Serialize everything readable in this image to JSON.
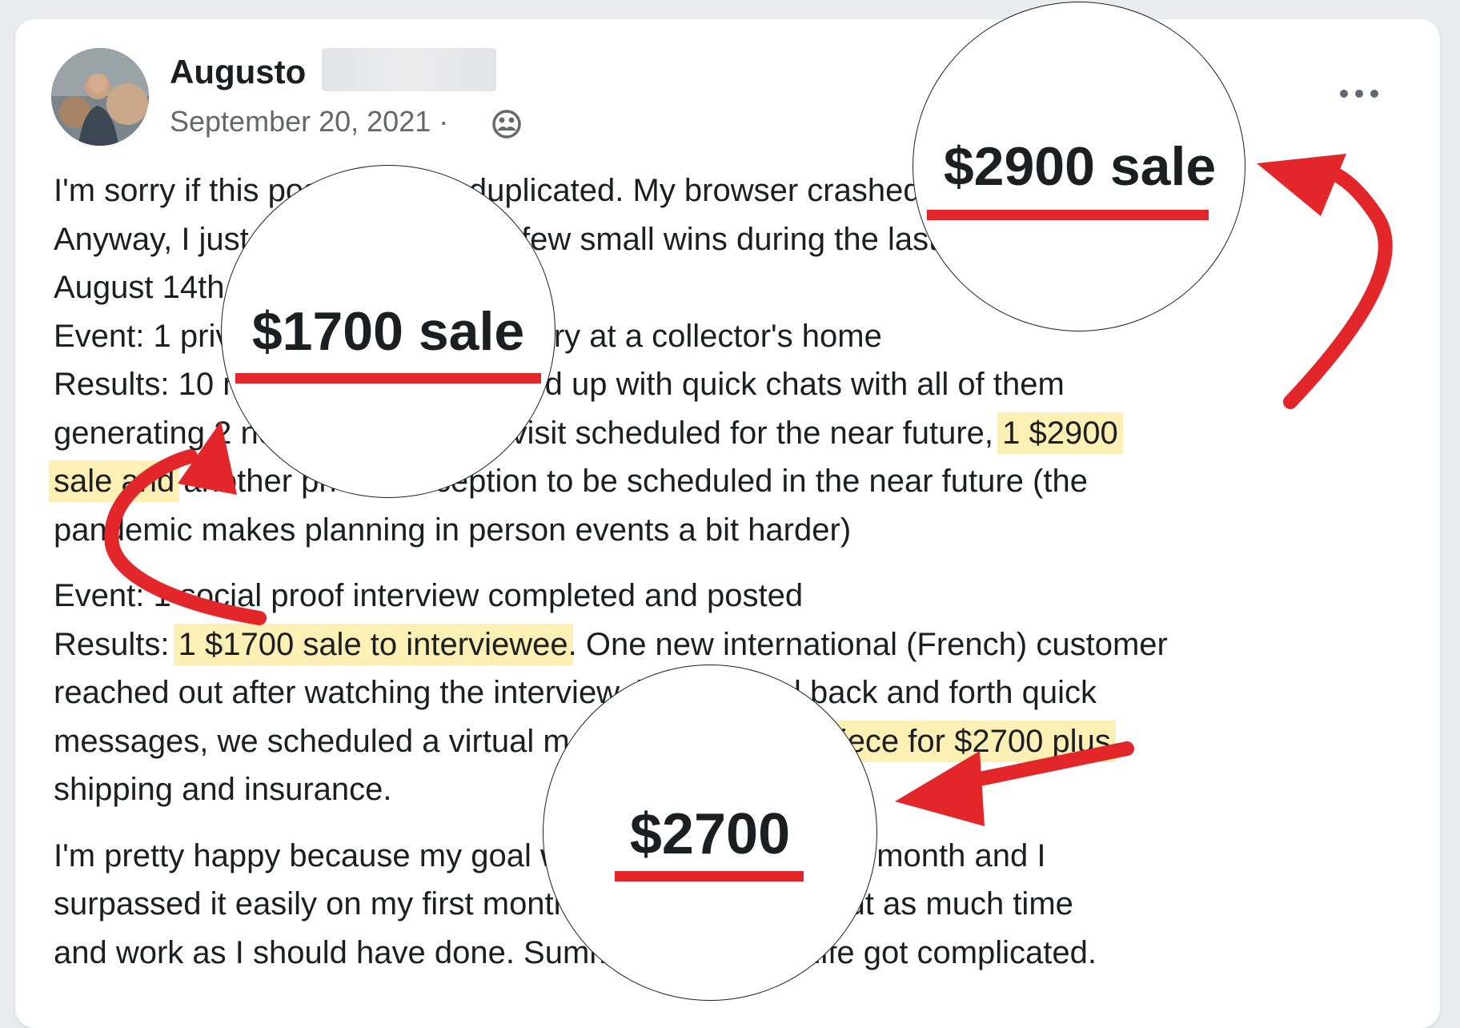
{
  "post": {
    "author": "Augusto",
    "date": "September 20, 2021 ·",
    "avatar": "avatar-photo",
    "audience_icon": "friends-icon",
    "more_icon": "more-options-icon",
    "paragraphs": {
      "p1": {
        "line1": "I'm sorry if this post might be duplicated. My browser crashed out.",
        "line2": "Anyway, I just wanted to share a few small wins during the last 5 weeks starting",
        "line3": "August 14th.",
        "line4": "Event: 1 private reception in a gallery at a collector's home",
        "line5": "Results: 10 new contacts, I followed up with quick chats with all of them",
        "line6_a": "generating 2 new leads, 1 more visit scheduled for the near future, ",
        "line6_hl": "1 $2900",
        "line7_hl": "sale and",
        "line7_b": " another private reception to be scheduled in the near future (the",
        "line8": "pandemic makes planning in person events a bit harder)"
      },
      "p2": {
        "line1": "Event: 1 social proof interview completed and posted",
        "line2_a": "Results: ",
        "line2_hl": "1 $1700 sale to interviewee",
        "line2_b": ". One new international (French) customer",
        "line3": "reached out after watching the interview, had several back and forth quick",
        "line4_a": "messages, we scheduled a virtual meeting and ",
        "line4_hl": "sold 1 piece for $2700 plus",
        "line5": "shipping and insurance."
      },
      "p3": {
        "line1": "I'm pretty happy because my goal was $3000 in sales per month and I",
        "line2": "surpassed it easily on my first month. In truth, I did not put as much time",
        "line3": "and work as I should have done. Summer ended and life got complicated."
      }
    }
  },
  "callouts": {
    "c1": "$2900 sale",
    "c2": "$1700 sale",
    "c3": "$2700"
  },
  "colors": {
    "highlight": "#fdf0b5",
    "accent_red": "#e3262a",
    "text": "#1c1e21",
    "secondary_text": "#65676b"
  }
}
